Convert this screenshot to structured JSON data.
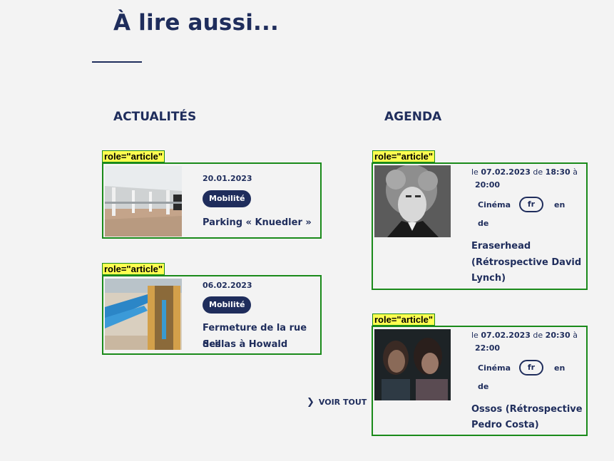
{
  "heading": "À lire aussi...",
  "columns": {
    "news_title": "ACTUALITÉS",
    "agenda_title": "AGENDA"
  },
  "role_label": "role=\"article\"",
  "news": [
    {
      "date": "20.01.2023",
      "tag": "Mobilité",
      "title": "Parking « Knuedler »"
    },
    {
      "date": "06.02.2023",
      "tag": "Mobilité",
      "title_line1": "Fermeture de la rue des",
      "title_line2": "Scillas à Howald"
    }
  ],
  "agenda": [
    {
      "le": "le",
      "date": "07.02.2023",
      "de": "de",
      "start": "18:30",
      "a": "à",
      "end": "20:00",
      "category": "Cinéma",
      "lang": "fr",
      "en": "en",
      "de2": "de",
      "title_line1": "Eraserhead",
      "title_line2": "(Rétrospective David",
      "title_line3": "Lynch)"
    },
    {
      "le": "le",
      "date": "07.02.2023",
      "de": "de",
      "start": "20:30",
      "a": "à",
      "end": "22:00",
      "category": "Cinéma",
      "lang": "fr",
      "en": "en",
      "de2": "de",
      "title_line1": "Ossos (Rétrospective",
      "title_line2": "Pedro Costa)"
    }
  ],
  "see_all": "VOIR TOUT",
  "icons": {
    "see_all": "chevron-right-icon"
  },
  "colors": {
    "accent": "#1f2d5c",
    "outline": "#1a8a1a",
    "tag_bg": "#ffff50"
  }
}
